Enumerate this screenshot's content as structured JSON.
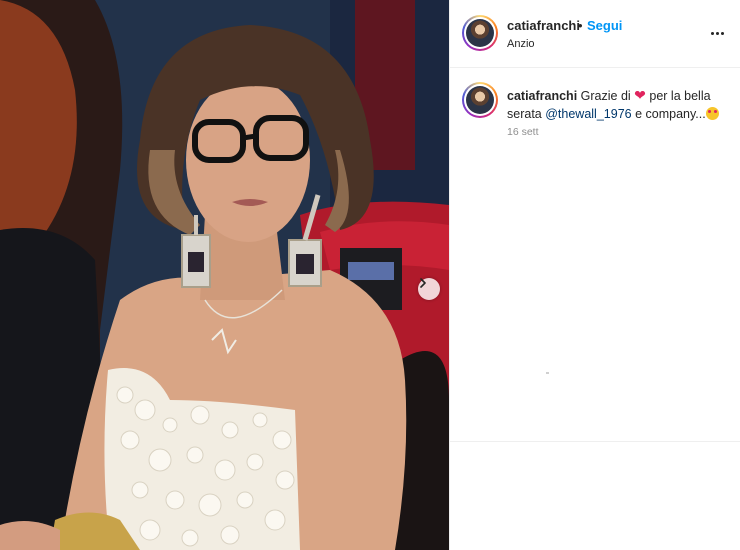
{
  "post": {
    "username": "catiafranchi",
    "separator": "•",
    "follow_label": "Segui",
    "location": "Anzio",
    "more_icon": "more-horizontal-icon"
  },
  "caption": {
    "username": "catiafranchi",
    "text_before": "Grazie di",
    "heart": "❤",
    "text_middle": "per la bella serata",
    "mention": "@thewall_1976",
    "text_after": "e company...",
    "emoji": "star-struck-emoji",
    "time": "16 sett"
  },
  "carousel": {
    "next_icon": "chevron-right-icon"
  },
  "colors": {
    "accent": "#0095f6",
    "mention": "#00376b",
    "muted": "#8e8e8e",
    "heart": "#e0245e"
  }
}
